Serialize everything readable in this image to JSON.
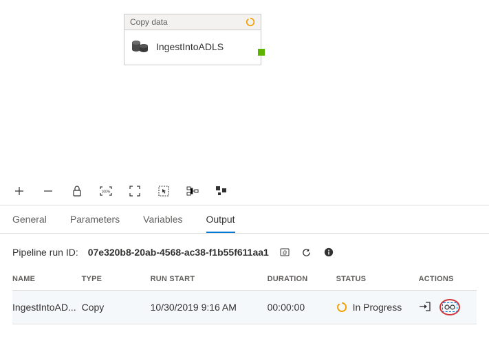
{
  "activity": {
    "type_label": "Copy data",
    "name": "IngestIntoADLS"
  },
  "tabs": {
    "general": "General",
    "parameters": "Parameters",
    "variables": "Variables",
    "output": "Output"
  },
  "run": {
    "label": "Pipeline run ID:",
    "id": "07e320b8-20ab-4568-ac38-f1b55f611aa1"
  },
  "columns": {
    "name": "NAME",
    "type": "TYPE",
    "run_start": "RUN START",
    "duration": "DURATION",
    "status": "STATUS",
    "actions": "ACTIONS"
  },
  "rows": [
    {
      "name": "IngestIntoAD...",
      "type": "Copy",
      "run_start": "10/30/2019 9:16 AM",
      "duration": "00:00:00",
      "status": "In Progress"
    }
  ]
}
